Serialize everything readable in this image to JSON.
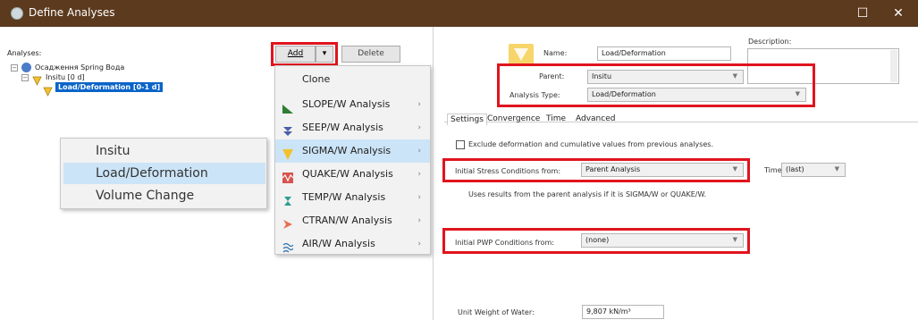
{
  "window": {
    "title": "Define Analyses",
    "maximize_glyph": "☐",
    "close_glyph": "✕"
  },
  "left": {
    "analyses_label": "Analyses:",
    "add_label": "Add",
    "add_arrow": "▾",
    "delete_label": "Delete",
    "tree": [
      {
        "text": "Осадження Spring Вода",
        "level": 0
      },
      {
        "text": "Insitu [0 d]",
        "level": 1
      },
      {
        "text": "Load/Deformation [0-1 d]",
        "level": 2,
        "selected": true
      }
    ]
  },
  "add_menu": {
    "items": [
      {
        "label": "Clone",
        "icon": "none",
        "submenu": false
      },
      {
        "label": "SLOPE/W Analysis",
        "icon": "slope-w-icon",
        "submenu": true
      },
      {
        "label": "SEEP/W Analysis",
        "icon": "seep-w-icon",
        "submenu": true
      },
      {
        "label": "SIGMA/W Analysis",
        "icon": "sigma-w-icon",
        "submenu": true,
        "highlighted": true
      },
      {
        "label": "QUAKE/W Analysis",
        "icon": "quake-w-icon",
        "submenu": true
      },
      {
        "label": "TEMP/W Analysis",
        "icon": "temp-w-icon",
        "submenu": true
      },
      {
        "label": "CTRAN/W Analysis",
        "icon": "ctran-w-icon",
        "submenu": true
      },
      {
        "label": "AIR/W Analysis",
        "icon": "air-w-icon",
        "submenu": true
      }
    ],
    "submenu_arrow": "›"
  },
  "sigma_submenu": {
    "items": [
      {
        "label": "Insitu",
        "highlighted": false
      },
      {
        "label": "Load/Deformation",
        "highlighted": true
      },
      {
        "label": "Volume Change",
        "highlighted": false
      }
    ]
  },
  "right": {
    "name_label": "Name:",
    "name_value": "Load/Deformation",
    "description_label": "Description:",
    "description_value": "",
    "parent_label": "Parent:",
    "parent_value": "Insitu",
    "type_label": "Analysis Type:",
    "type_value": "Load/Deformation",
    "tabs": [
      "Settings",
      "Convergence",
      "Time",
      "Advanced"
    ],
    "active_tab": "Settings",
    "exclude_checkbox_label": "Exclude deformation and cumulative values from previous analyses.",
    "stress_label": "Initial Stress Conditions from:",
    "stress_value": "Parent Analysis",
    "time_label": "Time:",
    "time_value": "(last)",
    "stress_note": "Uses results from the parent analysis if it is SIGMA/W or QUAKE/W.",
    "pwp_label": "Initial PWP Conditions from:",
    "pwp_value": "(none)",
    "unit_weight_label": "Unit Weight of Water:",
    "unit_weight_value": "9,807 kN/m³"
  },
  "colors": {
    "titlebar": "#5c3a1e",
    "highlight_red": "#e0141e",
    "selection": "#cce4f7",
    "tree_selected": "#0a64c8"
  }
}
